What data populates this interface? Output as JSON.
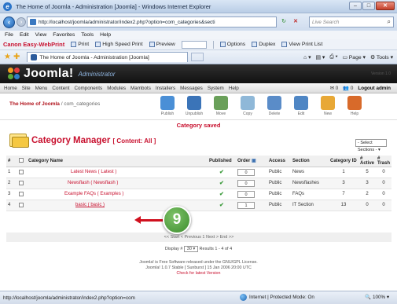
{
  "window": {
    "title": "The Home of Joomla - Administration [Joomla] - Windows Internet Explorer",
    "min": "–",
    "max": "□",
    "close": "✕"
  },
  "address": {
    "url": "http://localhost/joomla/administrator/index2.php?option=com_categories&secti",
    "search_placeholder": "Live Search"
  },
  "ie_menu": [
    "File",
    "Edit",
    "View",
    "Favorites",
    "Tools",
    "Help"
  ],
  "printbar": {
    "brand": "Canon Easy-WebPrint",
    "print": "Print",
    "hs_print": "High Speed Print",
    "preview": "Preview",
    "options": "Options",
    "duplex": "Duplex",
    "view_print_list": "View Print List"
  },
  "favbar": {
    "tab_title": "The Home of Joomla - Administration [Joomla]",
    "page": "Page",
    "tools": "Tools"
  },
  "joomla": {
    "name": "Joomla!",
    "admin": "Administrator",
    "version": "Version 1.0",
    "menu": [
      "Home",
      "Site",
      "Menu",
      "Content",
      "Components",
      "Modules",
      "Mambots",
      "Installers",
      "Messages",
      "System",
      "Help"
    ],
    "msg_count_1": "0",
    "msg_count_2": "0",
    "logout": "Logout admin",
    "breadcrumb_site": "The Home of Joomla",
    "breadcrumb_page": " / com_categories",
    "toolbar": [
      "Publish",
      "Unpublish",
      "Move",
      "Copy",
      "Delete",
      "Edit",
      "New",
      "Help"
    ],
    "saved_msg": "Category saved",
    "manager_title": "Category Manager",
    "manager_sub": "[ Content: All ]",
    "filter": "- Select Sections -",
    "columns": {
      "num": "#",
      "name": "Category Name",
      "published": "Published",
      "order": "Order",
      "access": "Access",
      "section": "Section",
      "cat_id": "Category ID",
      "active": "# Active",
      "trash": "# Trash"
    },
    "rows": [
      {
        "num": "1",
        "name": "Latest News ( Latest )",
        "order": "0",
        "access": "Public",
        "section": "News",
        "id": "1",
        "active": "5",
        "trash": "0"
      },
      {
        "num": "2",
        "name": "Newsflash ( Newsflash )",
        "order": "0",
        "access": "Public",
        "section": "Newsflashes",
        "id": "3",
        "active": "3",
        "trash": "0"
      },
      {
        "num": "3",
        "name": "Example FAQs ( Examples )",
        "order": "0",
        "access": "Public",
        "section": "FAQs",
        "id": "7",
        "active": "2",
        "trash": "0"
      },
      {
        "num": "4",
        "name": "basic ( basic )",
        "order": "1",
        "access": "Public",
        "section": "IT Section",
        "id": "13",
        "active": "0",
        "trash": "0"
      }
    ],
    "published_icon": "✔",
    "pager": "<< Start < Previous 1 Next > End >>",
    "display_label": "Display #",
    "display_value": "30",
    "results": "Results 1 - 4 of 4",
    "footer_1": "Joomla! is Free Software released under the GNU/GPL License.",
    "footer_2": "Joomla! 1.0.7 Stable [ Sunburst ] 15 Jan 2006 20:00 UTC",
    "footer_3": "Check for latest Version"
  },
  "callout": {
    "number": "9",
    "color": "#4aa038"
  },
  "status": {
    "url": "http://localhost/joomla/administrator/index2.php?option=com",
    "zone": "Internet | Protected Mode: On",
    "zoom": "100%"
  },
  "colors": {
    "joomla_red": "#c8102e",
    "header_bg": "#1a1a1a",
    "arrow": "#d0101e"
  }
}
